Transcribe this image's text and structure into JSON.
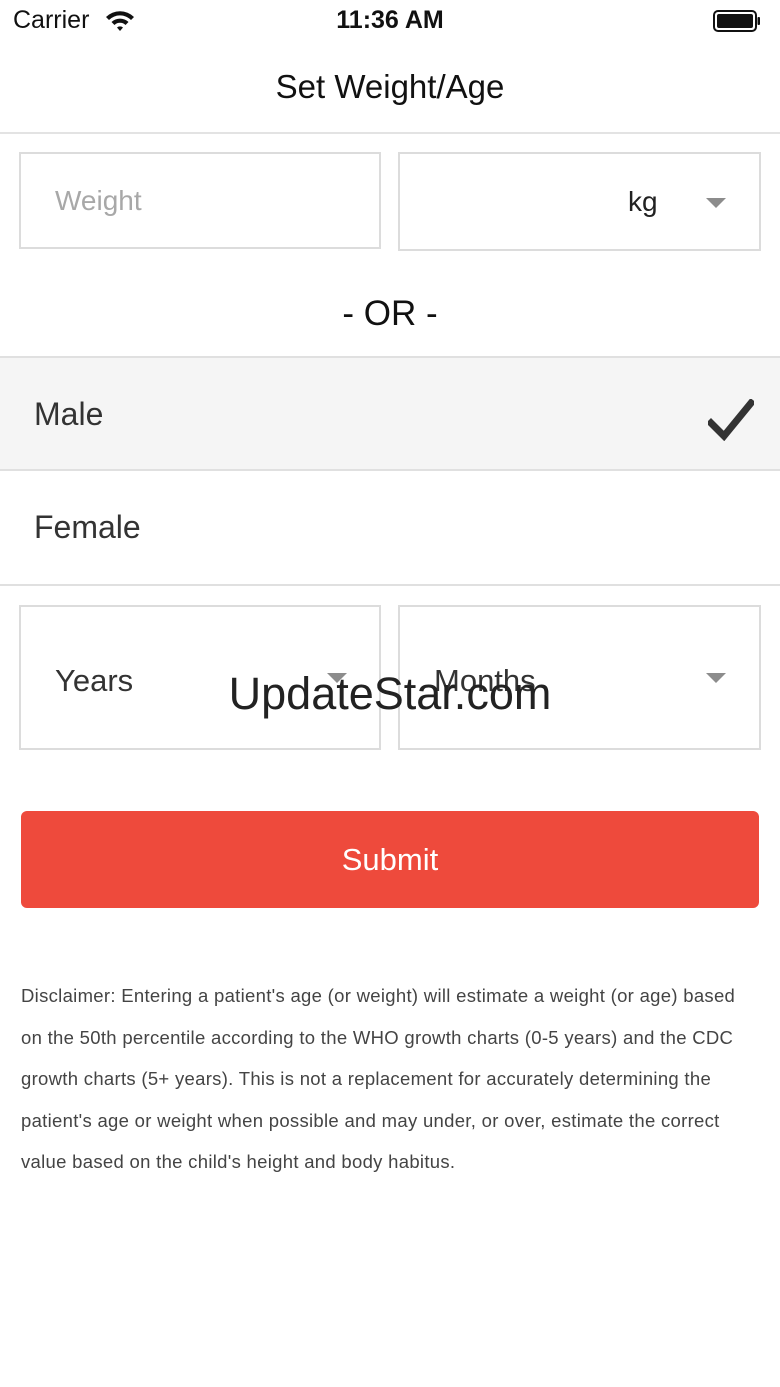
{
  "status_bar": {
    "carrier": "Carrier",
    "time": "11:36 AM"
  },
  "nav": {
    "title": "Set Weight/Age"
  },
  "weight": {
    "value": "",
    "placeholder": "Weight",
    "unit": "kg"
  },
  "divider_text": "- OR -",
  "sex_options": [
    {
      "label": "Male",
      "selected": true
    },
    {
      "label": "Female",
      "selected": false
    }
  ],
  "age": {
    "years_label": "Years",
    "months_label": "Months"
  },
  "submit_label": "Submit",
  "disclaimer": "Disclaimer: Entering a patient's age (or weight) will estimate a weight (or age) based on the 50th percentile according to the WHO growth charts (0-5 years) and the CDC growth charts (5+ years). This is not a replacement for accurately determining the patient's age or weight when possible and may under, or over, estimate the correct value based on the child's height and body habitus.",
  "watermark": "UpdateStar.com",
  "colors": {
    "accent": "#ee4a3c",
    "selected_row": "#f5f5f5",
    "checkmark": "#333333"
  },
  "icons": [
    "wifi-icon",
    "battery-icon",
    "dropdown-caret-icon",
    "checkmark-icon"
  ]
}
